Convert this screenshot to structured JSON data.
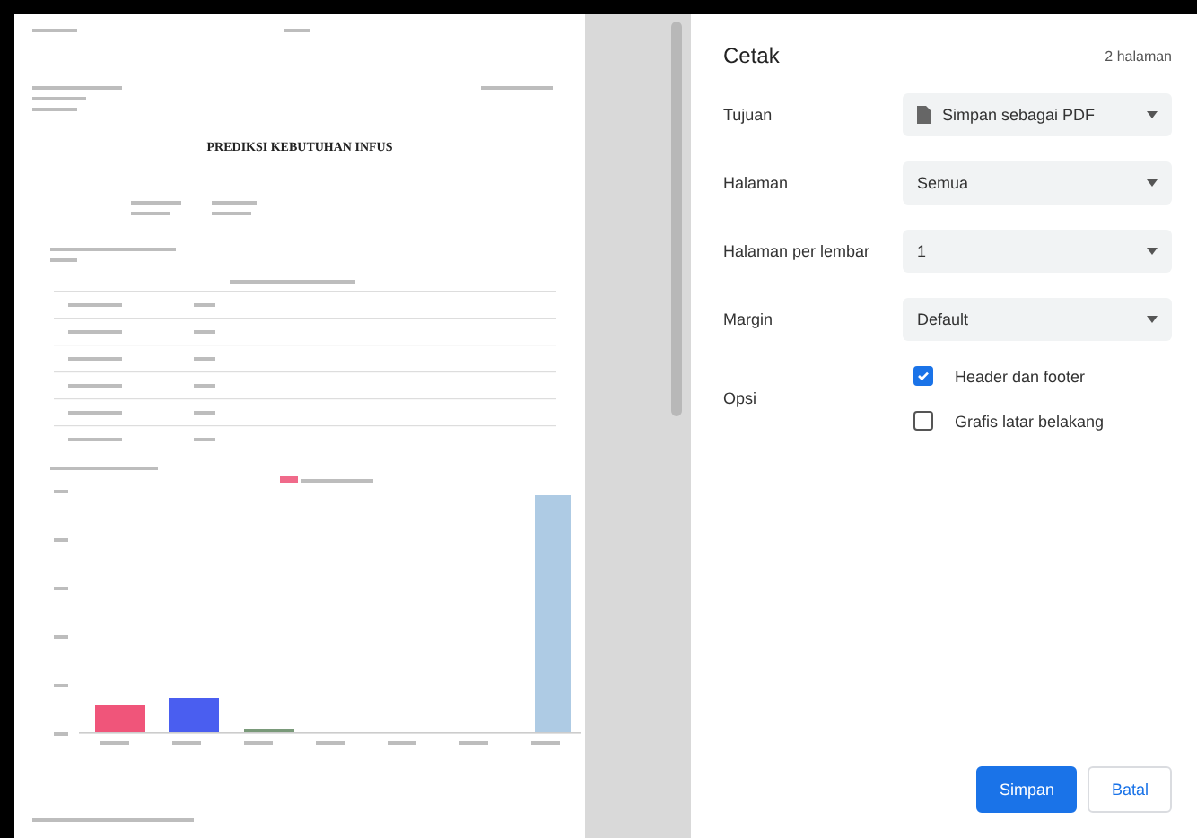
{
  "preview": {
    "title_line_1": "PREDIKSI KEBUTUHAN INFUS"
  },
  "settings": {
    "title": "Cetak",
    "page_count": "2 halaman",
    "rows": [
      {
        "label": "Tujuan",
        "kind": "select",
        "value": "Simpan sebagai PDF",
        "icon": true
      },
      {
        "label": "Halaman",
        "kind": "select",
        "value": "Semua",
        "icon": false
      },
      {
        "label": "Halaman per lembar",
        "kind": "select",
        "value": "1",
        "icon": false
      },
      {
        "label": "Margin",
        "kind": "select",
        "value": "Default",
        "icon": false
      },
      {
        "label": "Opsi",
        "kind": "checks",
        "options": [
          {
            "label": "Header dan footer",
            "checked": true
          },
          {
            "label": "Grafis latar belakang",
            "checked": false
          }
        ]
      }
    ],
    "buttons": [
      {
        "label": "Simpan",
        "kind": "primary"
      },
      {
        "label": "Batal",
        "kind": "secondary"
      }
    ]
  }
}
